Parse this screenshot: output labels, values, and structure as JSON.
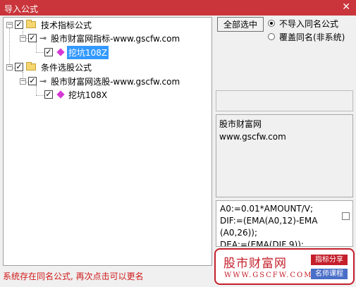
{
  "window": {
    "title": "导入公式",
    "close_glyph": "✕"
  },
  "tree": {
    "nodes": [
      {
        "label": "技术指标公式",
        "checked": true
      },
      {
        "label": "股市财富网指标-www.gscfw.com",
        "checked": true
      },
      {
        "label": "挖坑108Z",
        "checked": true,
        "selected": true
      },
      {
        "label": "条件选股公式",
        "checked": true
      },
      {
        "label": "股市财富网选股-www.gscfw.com",
        "checked": true
      },
      {
        "label": "挖坑108X",
        "checked": true
      }
    ],
    "expander_glyph": "−",
    "check_glyph": "✓"
  },
  "options": {
    "select_all_label": "全部选中",
    "radio_skip_label": "不导入同名公式",
    "radio_overwrite_label": "覆盖同名(非系统)",
    "selected_radio": "skip"
  },
  "description": {
    "line1": "股市财富网",
    "line2": "www.gscfw.com"
  },
  "code": {
    "line1": "A0:=0.01*AMOUNT/V;",
    "line2": "DIF:=(EMA(A0,12)-EMA",
    "line3": "(A0,26));",
    "line4": "DEA:=(EMA(DIF,9));"
  },
  "status": {
    "message": "系统存在同名公式, 再次点击可以更名"
  },
  "watermark": {
    "brand": "股市财富网",
    "url": "WWW.GSCFW.COM",
    "tag1": "指标分享",
    "tag2": "名师课程"
  },
  "colors": {
    "titlebar": "#c9353b",
    "selection": "#3399ff",
    "status_text": "#d11a1a",
    "watermark_red": "#c41f2b",
    "watermark_blue": "#4a6fc8"
  },
  "icons": {
    "folder": "folder-icon",
    "key": "key-icon",
    "formula": "formula-diamond-icon",
    "close": "close-icon"
  }
}
